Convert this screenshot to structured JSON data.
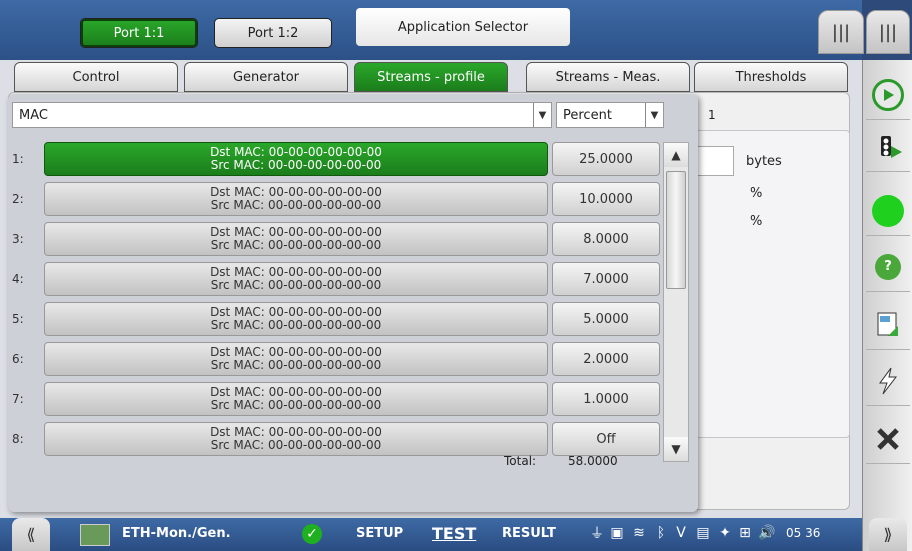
{
  "header": {
    "port_tabs": [
      "Port 1:1",
      "Port 1:2"
    ],
    "app_selector": "Application Selector",
    "menu_icon": "|||"
  },
  "tabs": [
    {
      "label": "Control"
    },
    {
      "label": "Generator"
    },
    {
      "label": "Streams - profile"
    },
    {
      "label": "Streams - Meas."
    },
    {
      "label": "Thresholds"
    }
  ],
  "list": {
    "mac_select": "MAC",
    "unit_select": "Percent",
    "count": "1",
    "rows": [
      {
        "num": "1:",
        "dst": "Dst MAC: 00-00-00-00-00-00",
        "src": "Src MAC: 00-00-00-00-00-00",
        "value": "25.0000"
      },
      {
        "num": "2:",
        "dst": "Dst MAC: 00-00-00-00-00-00",
        "src": "Src MAC: 00-00-00-00-00-00",
        "value": "10.0000"
      },
      {
        "num": "3:",
        "dst": "Dst MAC: 00-00-00-00-00-00",
        "src": "Src MAC: 00-00-00-00-00-00",
        "value": "8.0000"
      },
      {
        "num": "4:",
        "dst": "Dst MAC: 00-00-00-00-00-00",
        "src": "Src MAC: 00-00-00-00-00-00",
        "value": "7.0000"
      },
      {
        "num": "5:",
        "dst": "Dst MAC: 00-00-00-00-00-00",
        "src": "Src MAC: 00-00-00-00-00-00",
        "value": "5.0000"
      },
      {
        "num": "6:",
        "dst": "Dst MAC: 00-00-00-00-00-00",
        "src": "Src MAC: 00-00-00-00-00-00",
        "value": "2.0000"
      },
      {
        "num": "7:",
        "dst": "Dst MAC: 00-00-00-00-00-00",
        "src": "Src MAC: 00-00-00-00-00-00",
        "value": "1.0000"
      },
      {
        "num": "8:",
        "dst": "Dst MAC: 00-00-00-00-00-00",
        "src": "Src MAC: 00-00-00-00-00-00",
        "value": "Off"
      }
    ],
    "total_label": "Total:",
    "total_value": "58.0000"
  },
  "background_panel": {
    "unit_bytes": "bytes",
    "unit_pct_1": "%",
    "unit_pct_2": "%"
  },
  "status_bar": {
    "app_name": "ETH-Mon./Gen.",
    "setup": "SETUP",
    "test": "TEST",
    "result": "RESULT",
    "time": "05 36"
  },
  "colors": {
    "accent_green": "#1f8f1f",
    "header_blue": "#3e6aa5"
  }
}
